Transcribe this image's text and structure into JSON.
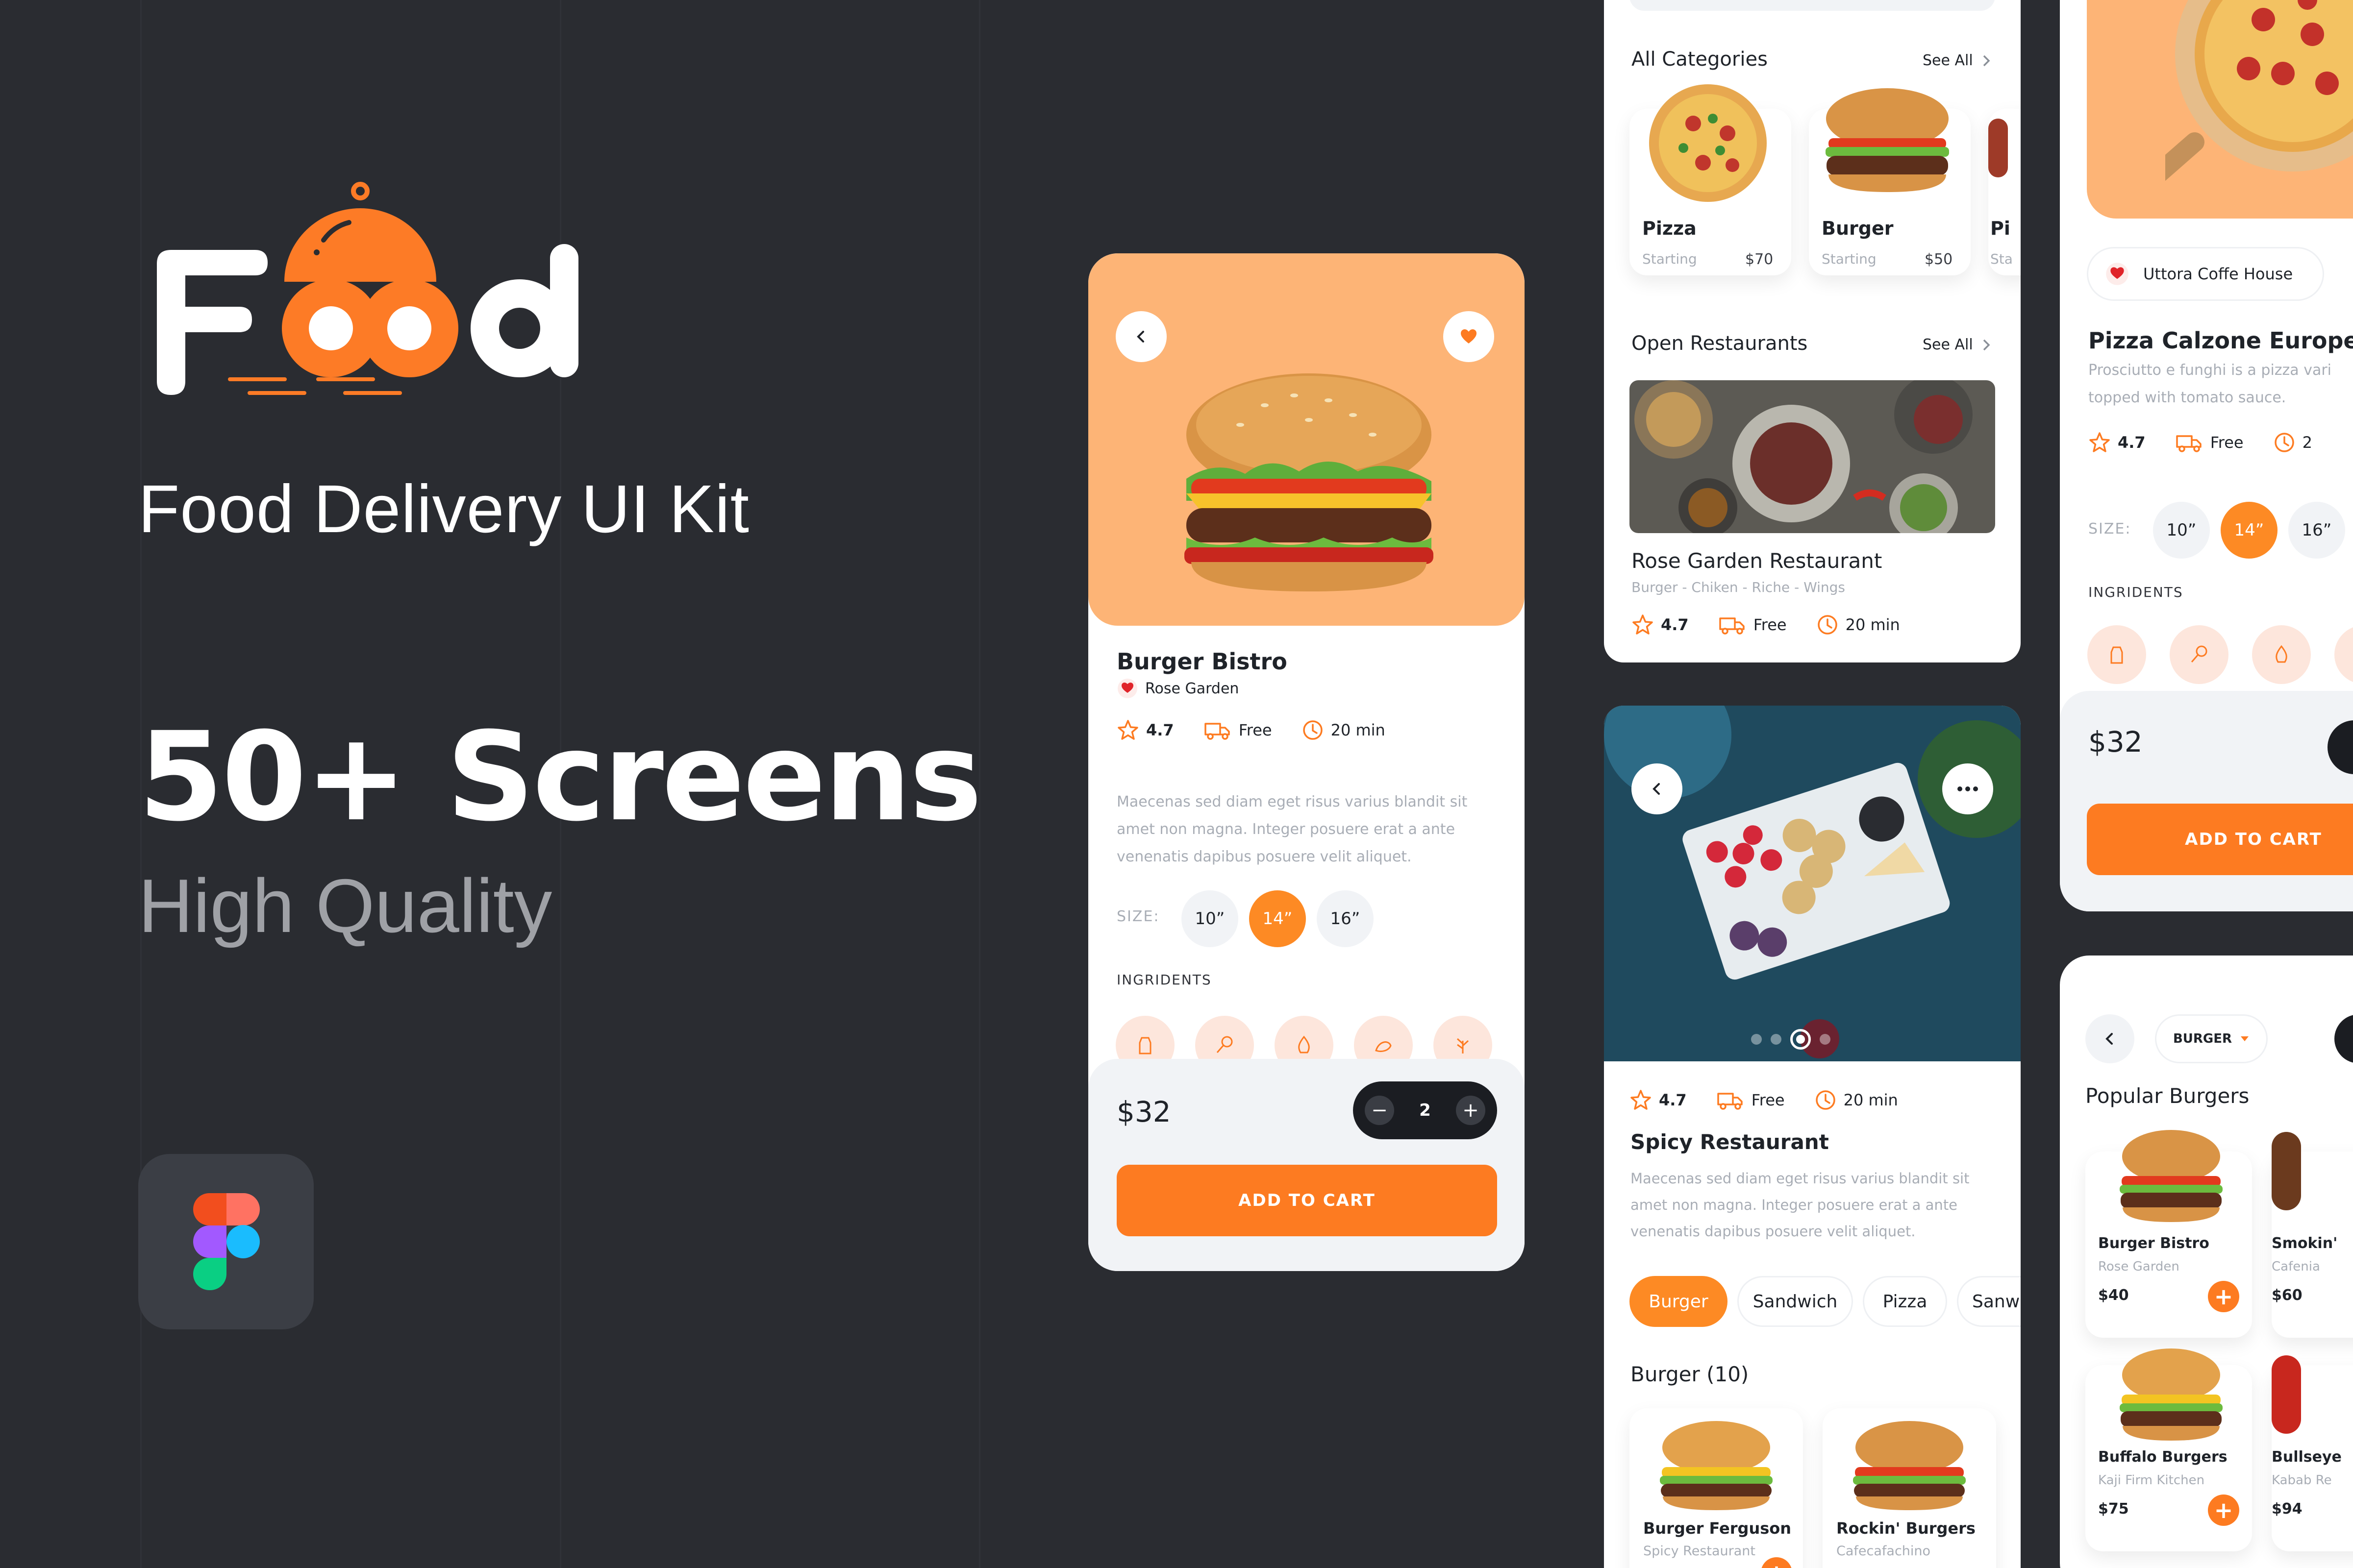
{
  "hero": {
    "logo_text": "Food",
    "subtitle": "Food Delivery UI Kit",
    "headline": "50+ Screens",
    "tagline": "High Quality"
  },
  "detail_card": {
    "title": "Burger Bistro",
    "restaurant": "Rose Garden",
    "rating": "4.7",
    "delivery": "Free",
    "time": "20 min",
    "description": "Maecenas sed diam eget risus varius blandit sit amet non magna. Integer posuere erat a ante venenatis dapibus posuere velit aliquet.",
    "size_label": "SIZE:",
    "sizes": [
      "10”",
      "14”",
      "16”"
    ],
    "selected_size": "14”",
    "ingredients_label": "INGRIDENTS",
    "price": "$32",
    "quantity": "2",
    "cta": "ADD TO CART"
  },
  "home_card": {
    "categories_title": "All Categories",
    "see_all": "See All",
    "categories": [
      {
        "name": "Pizza",
        "starting": "Starting",
        "price": "$70"
      },
      {
        "name": "Burger",
        "starting": "Starting",
        "price": "$50"
      },
      {
        "name": "Pi",
        "starting": "Sta",
        "price": ""
      }
    ],
    "open_title": "Open Restaurants",
    "open_see_all": "See All",
    "restaurant_name": "Rose Garden Restaurant",
    "restaurant_tags": "Burger - Chiken - Riche - Wings",
    "rating": "4.7",
    "delivery": "Free",
    "time": "20 min"
  },
  "spicy_card": {
    "rating": "4.7",
    "delivery": "Free",
    "time": "20 min",
    "title": "Spicy Restaurant",
    "description": "Maecenas sed diam eget risus varius blandit sit amet non magna. Integer posuere erat a ante venenatis dapibus posuere velit aliquet.",
    "chips": [
      "Burger",
      "Sandwich",
      "Pizza",
      "Sanwi"
    ],
    "section": "Burger (10)",
    "items": [
      {
        "name": "Burger Ferguson",
        "place": "Spicy Restaurant"
      },
      {
        "name": "Rockin' Burgers",
        "place": "Cafecafachino"
      }
    ]
  },
  "pizza_card": {
    "restaurant": "Uttora Coffe House",
    "title": "Pizza Calzone Europea",
    "description_1": "Prosciutto e funghi is a pizza vari",
    "description_2": "topped with tomato sauce.",
    "rating": "4.7",
    "delivery": "Free",
    "time": "2",
    "size_label": "SIZE:",
    "sizes": [
      "10”",
      "14”",
      "16”"
    ],
    "selected_size": "14”",
    "ingredients_label": "INGRIDENTS",
    "price": "$32",
    "cta": "ADD TO CART"
  },
  "popular_card": {
    "dropdown": "BURGER",
    "title": "Popular Burgers",
    "items": [
      {
        "name": "Burger Bistro",
        "place": "Rose Garden",
        "price": "$40"
      },
      {
        "name": "Smokin'",
        "place": "Cafenia",
        "price": "$60"
      },
      {
        "name": "Buffalo Burgers",
        "place": "Kaji Firm Kitchen",
        "price": "$75"
      },
      {
        "name": "Bullseye",
        "place": "Kabab Re",
        "price": "$94"
      }
    ]
  },
  "colors": {
    "accent": "#fd7b21",
    "background": "#2a2c31",
    "peach": "#fdb476"
  }
}
